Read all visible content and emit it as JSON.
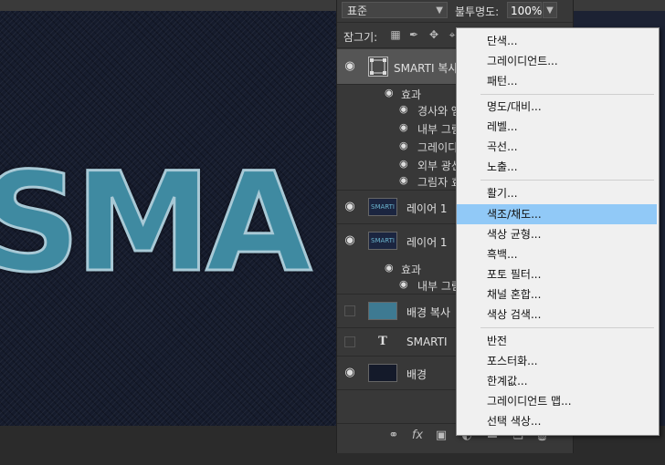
{
  "canvas": {
    "text": "SMA"
  },
  "layers_panel": {
    "blend_mode": "표준",
    "opacity_label": "불투명도:",
    "opacity_value": "100%",
    "lock_label": "잠그기:",
    "layers": [
      {
        "name": "SMARTI 복사",
        "thumb_type": "smart-object",
        "visible": true,
        "selected": true,
        "effects_label": "효과",
        "effects": [
          "경사와 엠",
          "내부 그림",
          "그레이디",
          "외부 광선",
          "그림자 효"
        ]
      },
      {
        "name": "레이어 1",
        "thumb_type": "smart-text",
        "thumb_text": "SMARTI",
        "visible": true
      },
      {
        "name": "레이어 1",
        "thumb_type": "smart-text",
        "thumb_text": "SMARTI",
        "visible": true,
        "effects_label": "효과",
        "effects": [
          "내부 그림"
        ]
      },
      {
        "name": "배경 복사",
        "thumb_type": "blue",
        "visible": false
      },
      {
        "name": "SMARTI",
        "thumb_type": "type",
        "thumb_text": "T",
        "visible": false
      },
      {
        "name": "배경",
        "thumb_type": "dark",
        "visible": true
      }
    ],
    "bottom_icons": [
      "link-icon",
      "fx-icon",
      "mask-icon",
      "adjustment-icon",
      "group-icon",
      "new-layer-icon",
      "trash-icon"
    ]
  },
  "context_menu": {
    "groups": [
      [
        "단색...",
        "그레이디언트...",
        "패턴..."
      ],
      [
        "명도/대비...",
        "레벨...",
        "곡선...",
        "노출..."
      ],
      [
        "활기...",
        "색조/채도...",
        "색상 균형...",
        "흑백...",
        "포토 필터...",
        "채널 혼합...",
        "색상 검색..."
      ],
      [
        "반전",
        "포스터화...",
        "한계값...",
        "그레이디언트 맵...",
        "선택 색상..."
      ]
    ],
    "highlighted": "색조/채도..."
  },
  "colors": {
    "panel_bg": "#383838",
    "menu_bg": "#f0f0f0",
    "menu_highlight": "#91c9f7",
    "canvas_bg": "#151b2c",
    "denim_blue": "#3f8aa1"
  }
}
